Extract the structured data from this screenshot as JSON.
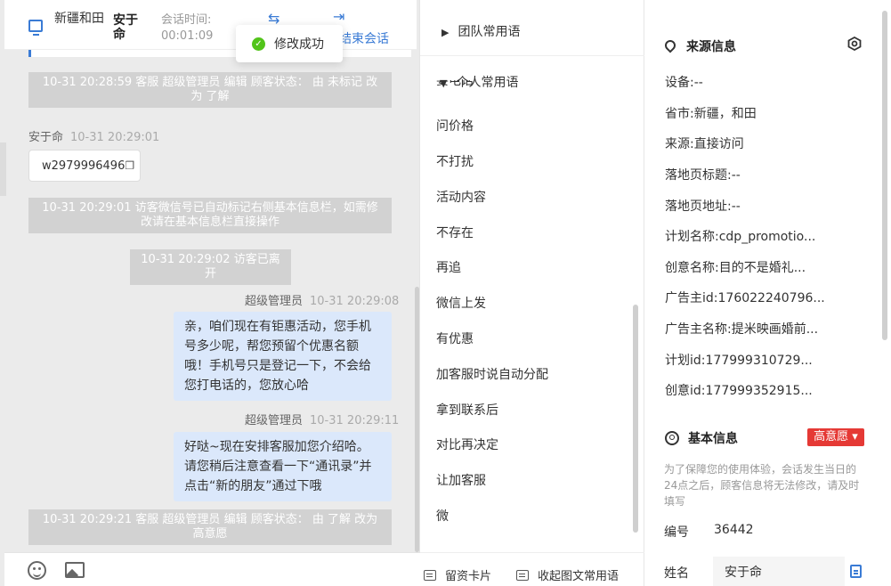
{
  "header": {
    "location": "新疆和田",
    "visitor_name": "安于命",
    "session_label": "会话时间:",
    "session_time": "00:01:09",
    "transfer_icon": "⇆",
    "end_label": "结束会话"
  },
  "toast": {
    "text": "修改成功",
    "icon": "check-circle"
  },
  "chat": {
    "sys1": "10-31 20:28:59 客服 超级管理员 编辑 顾客状态： 由 未标记 改为 了解",
    "visitor_name": "安于命",
    "visitor_time": "10-31 20:29:01",
    "wechat_card": "w2979996496",
    "copy_glyph": "❐",
    "sys2": "10-31 20:29:01 访客微信号已自动标记右侧基本信息栏，如需修改请在基本信息栏直接操作",
    "sys3": "10-31 20:29:02 访客已离开",
    "agent_name": "超级管理员",
    "agent_time1": "10-31 20:29:08",
    "msg1": "亲，咱们现在有钜惠活动，您手机号多少呢，帮您预留个优惠名额哦！手机号只是登记一下，不会给您打电话的，您放心哈",
    "agent_time2": "10-31 20:29:11",
    "msg2": "好哒~现在安排客服加您介绍哈。请您稍后注意查看一下“通讯录”并点击“新的朋友”通过下哦",
    "sys4": "10-31 20:29:21 客服 超级管理员 编辑 顾客状态： 由 了解 改为 高意愿"
  },
  "phrases": {
    "team_group": "团队常用语",
    "personal_group": "个人常用语",
    "collapsed_glyph": "▶",
    "expanded_glyph": "▼",
    "cut_item": "要电话",
    "items": [
      "问价格",
      "不打扰",
      "活动内容",
      "不存在",
      "再追",
      "微信上发",
      "有优惠",
      "加客服时说自动分配",
      "拿到联系后",
      "对比再决定",
      "让加客服",
      "微"
    ],
    "footer_card": "留资卡片",
    "footer_collapse": "收起图文常用语"
  },
  "info": {
    "source_title": "来源信息",
    "rows": [
      {
        "label": "设备:",
        "value": "--"
      },
      {
        "label": "省市:",
        "value": "新疆，和田"
      },
      {
        "label": "来源:",
        "value": "直接访问"
      },
      {
        "label": "落地页标题:",
        "value": "--"
      },
      {
        "label": "落地页地址:",
        "value": "--"
      },
      {
        "label": "计划名称:",
        "value": "cdp_promotio..."
      },
      {
        "label": "创意名称:",
        "value": "目的不是婚礼..."
      },
      {
        "label": "广告主id:",
        "value": "176022240796..."
      },
      {
        "label": "广告主名称:",
        "value": "提米映画婚前..."
      },
      {
        "label": "计划id:",
        "value": "177999310729..."
      },
      {
        "label": "创意id:",
        "value": "177999352915..."
      }
    ],
    "basic_title": "基本信息",
    "intent_badge": "高意愿 ▾",
    "note": "为了保障您的使用体验，会话发生当日的24点之后，顾客信息将无法修改，请及时填写",
    "number_label": "编号",
    "number_value": "36442",
    "name_label": "姓名",
    "name_value": "安于命"
  }
}
